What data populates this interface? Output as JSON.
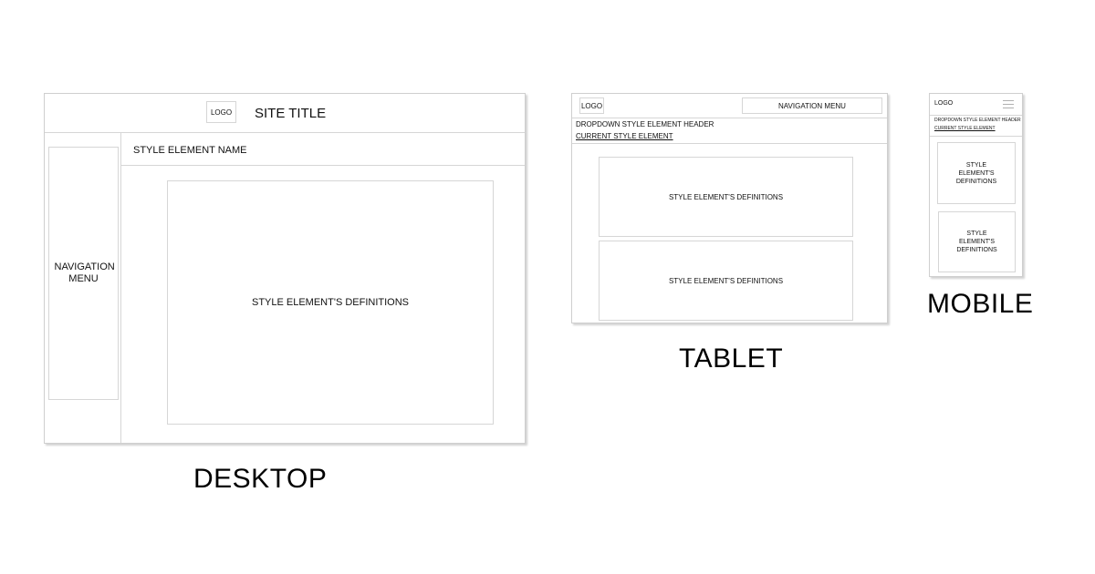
{
  "desktop": {
    "logo": "LOGO",
    "site_title": "SITE TITLE",
    "navigation_menu": "NAVIGATION MENU",
    "style_element_name": "STYLE ELEMENT NAME",
    "definitions": "STYLE ELEMENT'S DEFINITIONS",
    "caption": "DESKTOP"
  },
  "tablet": {
    "logo": "LOGO",
    "navigation_menu": "NAVIGATION MENU",
    "dropdown_header": "DROPDOWN STYLE ELEMENT HEADER",
    "current_element": "CURRENT STYLE ELEMENT",
    "definitions": [
      "STYLE ELEMENT'S DEFINITIONS",
      "STYLE ELEMENT'S DEFINITIONS"
    ],
    "caption": "TABLET"
  },
  "mobile": {
    "logo": "LOGO",
    "menu_icon": "hamburger-menu-icon",
    "dropdown_header": "DROPDOWN STYLE ELEMENT HEADER",
    "current_element": "CURRENT STYLE ELEMENT",
    "definitions": [
      "STYLE ELEMENT'S DEFINITIONS",
      "STYLE ELEMENT'S DEFINITIONS"
    ],
    "caption": "MOBILE"
  }
}
